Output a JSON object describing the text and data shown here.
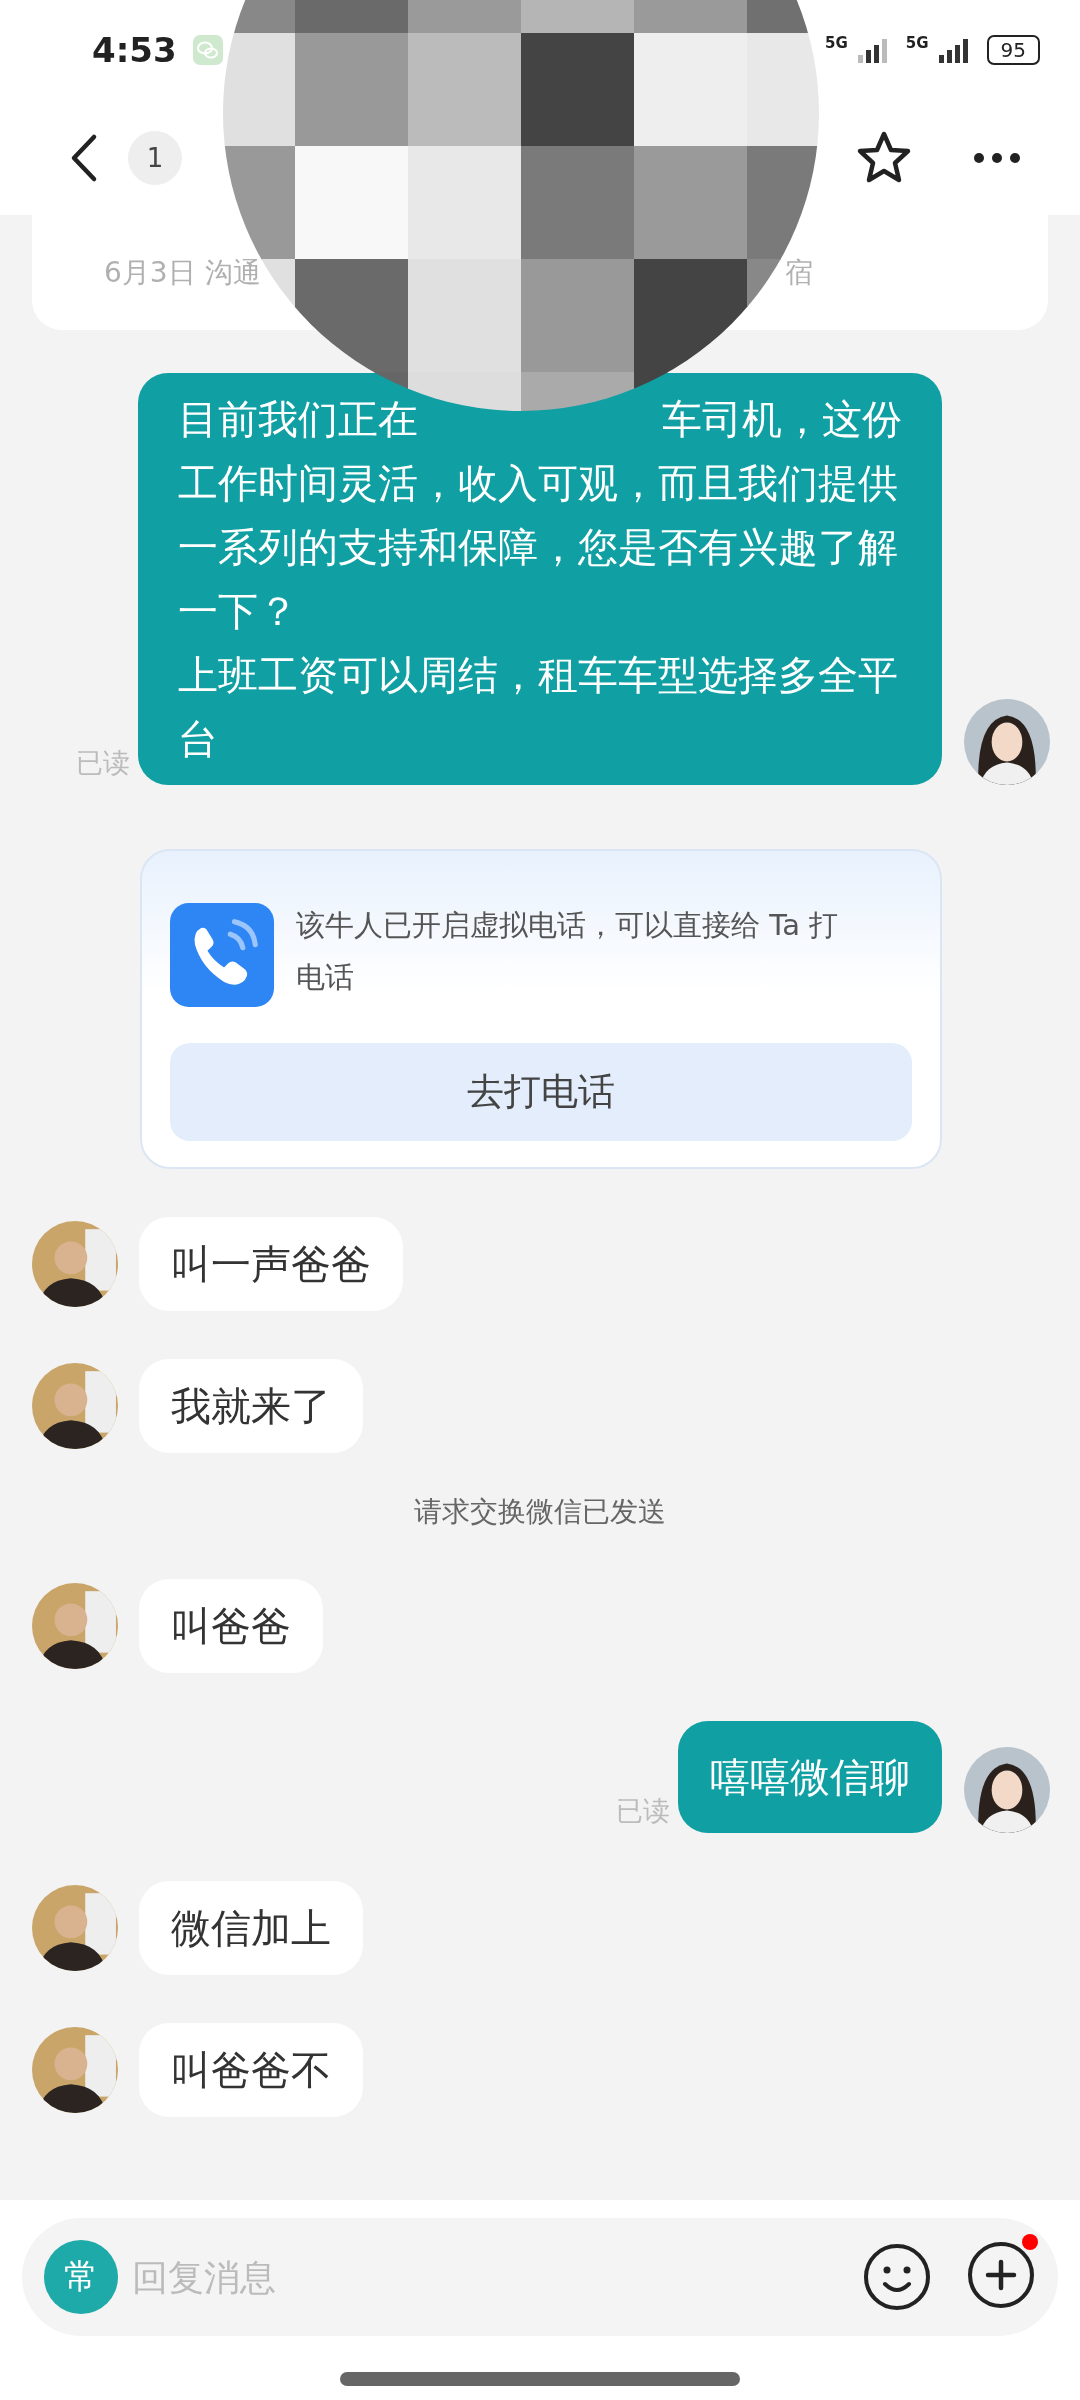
{
  "status_bar": {
    "time": "4:53",
    "battery": "95",
    "network_1": "5G",
    "network_2": "5G"
  },
  "header": {
    "unread_count": "1"
  },
  "pinned_card": {
    "text_start": "6月3日 沟通",
    "text_end": "宿"
  },
  "messages": [
    {
      "kind": "sent",
      "first_line_start": "目前我们正在",
      "first_line_end": "车司机，这份",
      "paragraphs": [
        "工作时间灵活，收入可观，而且我们提供一系列的支持和保障，您是否有兴趣了解一下？",
        "上班工资可以周结，租车车型选择多全平台"
      ],
      "read_label": "已读"
    },
    {
      "kind": "call_card",
      "text": "该牛人已开启虚拟电话，可以直接给 Ta 打电话",
      "button": "去打电话"
    },
    {
      "kind": "received",
      "text": "叫一声爸爸"
    },
    {
      "kind": "received",
      "text": "我就来了"
    },
    {
      "kind": "system",
      "text": "请求交换微信已发送"
    },
    {
      "kind": "received",
      "text": "叫爸爸"
    },
    {
      "kind": "sent",
      "paragraphs": [
        "嘻嘻微信聊"
      ],
      "read_label": "已读"
    },
    {
      "kind": "received",
      "text": "微信加上"
    },
    {
      "kind": "received",
      "text": "叫爸爸不"
    }
  ],
  "input_bar": {
    "quick_reply": "常",
    "placeholder": "回复消息",
    "plus_badge": true
  }
}
